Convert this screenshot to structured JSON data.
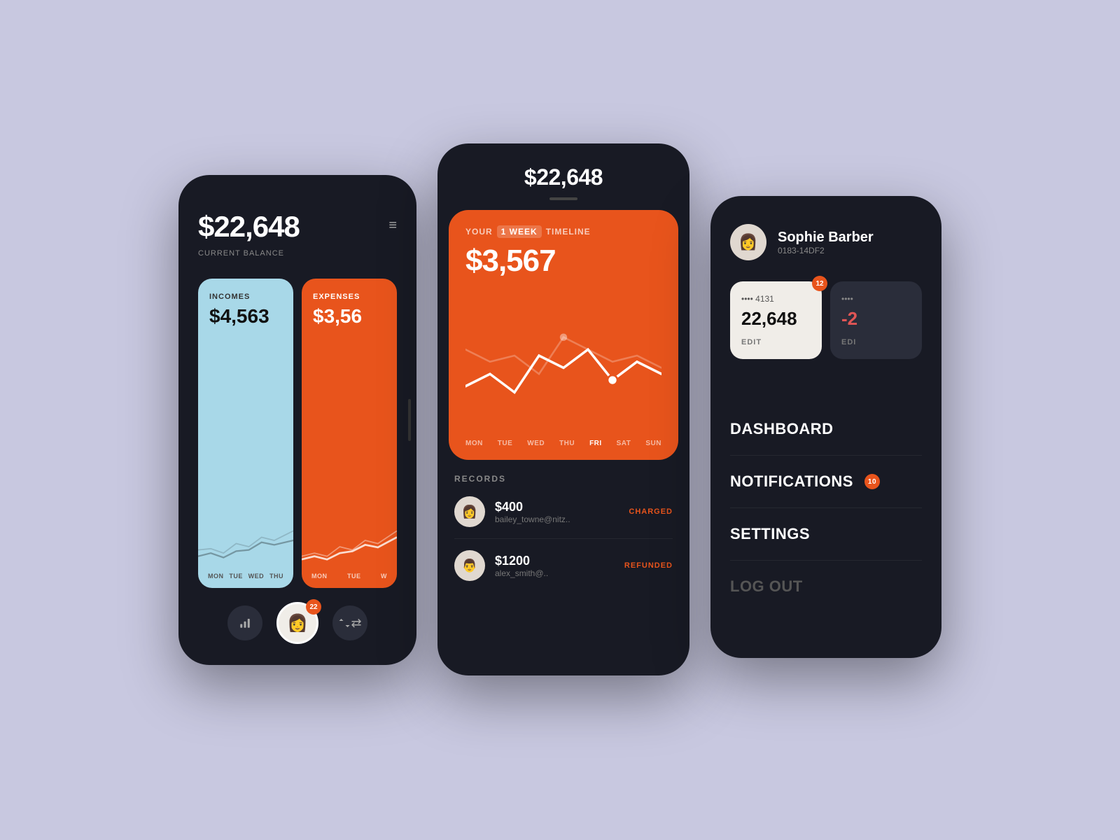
{
  "page": {
    "bg_color": "#c8c8e0"
  },
  "phone1": {
    "balance_amount": "$22,648",
    "balance_label": "CURRENT BALANCE",
    "income_card": {
      "title": "INCOMES",
      "amount": "$4,563",
      "days": [
        "MON",
        "TUE",
        "WED",
        "THU"
      ]
    },
    "expense_card": {
      "title": "EXPENSES",
      "amount": "$3,56",
      "days": [
        "MON",
        "TUE",
        "W"
      ]
    },
    "notification_count": "22"
  },
  "phone2": {
    "top_amount": "$22,648",
    "timeline_card": {
      "label_your": "YOUR",
      "label_week": "1 WEEK",
      "label_timeline": "TIMELINE",
      "amount": "$3,567",
      "days": [
        "MON",
        "TUE",
        "WED",
        "THU",
        "FRI",
        "SAT",
        "SUN"
      ]
    },
    "records_title": "RECORDS",
    "records": [
      {
        "amount": "$400",
        "email": "bailey_towne@nitz..",
        "status": "CHARGED",
        "avatar_emoji": "👩"
      },
      {
        "amount": "$1200",
        "email": "alex_smith@..",
        "status": "REFUNDED",
        "avatar_emoji": "👨"
      }
    ]
  },
  "phone3": {
    "user": {
      "name": "Sophie Barber",
      "id": "0183-14DF2",
      "avatar_emoji": "👩"
    },
    "cards": [
      {
        "number": "•••• 4131",
        "balance": "22,648",
        "edit_label": "EDIT",
        "badge": "12"
      },
      {
        "number": "••••",
        "balance": "-2",
        "edit_label": "EDI"
      }
    ],
    "nav_items": [
      {
        "label": "DASHBOARD",
        "badge": null
      },
      {
        "label": "NOTIFICATIONS",
        "badge": "10"
      },
      {
        "label": "SETTINGS",
        "badge": null
      }
    ],
    "logout_label": "LOG OUT"
  }
}
